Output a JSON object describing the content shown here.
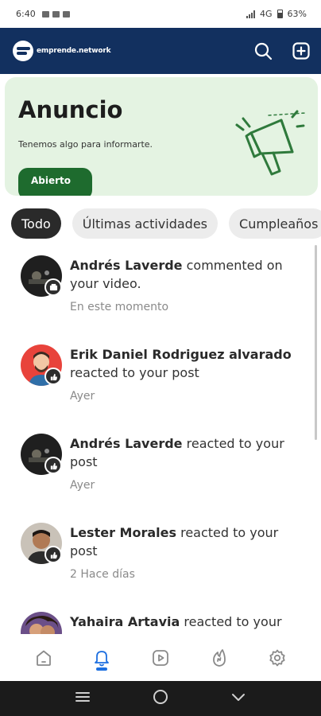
{
  "status_bar": {
    "time": "6:40",
    "network": "4G",
    "battery": "63%"
  },
  "header": {
    "logo_text": "emprende.network"
  },
  "banner": {
    "title": "Anuncio",
    "text": "Tenemos algo para informarte.",
    "button_label": "Abierto"
  },
  "chips": [
    {
      "label": "Todo",
      "active": true
    },
    {
      "label": "Últimas actividades",
      "active": false
    },
    {
      "label": "Cumpleaños",
      "active": false
    }
  ],
  "notifications": [
    {
      "name": "Andrés Laverde",
      "action": "commented on your video.",
      "time": "En este momento",
      "avatar": "dark"
    },
    {
      "name": "Erik Daniel Rodriguez alvarado",
      "action": "reacted to your post",
      "time": "Ayer",
      "avatar": "cartoon"
    },
    {
      "name": "Andrés Laverde",
      "action": "reacted to your post",
      "time": "Ayer",
      "avatar": "dark"
    },
    {
      "name": "Lester Morales",
      "action": "reacted to your post",
      "time": "2 Hace días",
      "avatar": "photo"
    },
    {
      "name": "Yahaira Artavia",
      "action": "reacted to your post",
      "time": "",
      "avatar": "photo2"
    }
  ],
  "colors": {
    "header_bg": "#12305f",
    "banner_bg": "#e4f3e2",
    "banner_button": "#1e6b2e",
    "active_nav": "#1d6fe0"
  },
  "bottom_nav": [
    "home-icon",
    "bell-icon",
    "video-icon",
    "flame-icon",
    "gear-icon"
  ]
}
